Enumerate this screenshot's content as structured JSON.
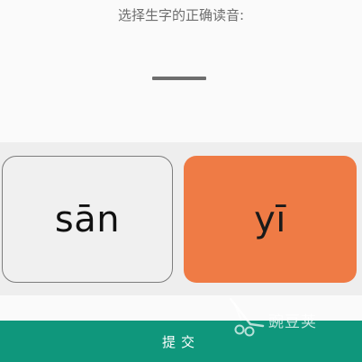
{
  "question": {
    "prompt": "选择生字的正确读音:"
  },
  "options": [
    {
      "label": "sān",
      "selected": false
    },
    {
      "label": "yī",
      "selected": true
    }
  ],
  "submit": {
    "label": "提交"
  },
  "watermark": {
    "text": "豌豆荚"
  },
  "colors": {
    "background": "#fafafa",
    "options_band": "#eeeeee",
    "option_default": "#f0f0f0",
    "option_selected": "#ef7b45",
    "submit_bar": "#0f977c"
  }
}
